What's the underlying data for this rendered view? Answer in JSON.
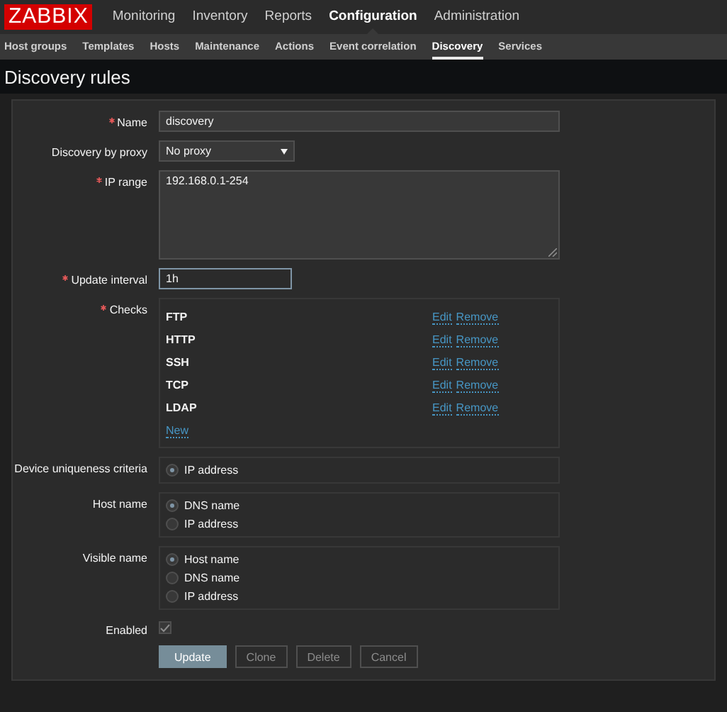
{
  "brand": "ZABBIX",
  "main_menu": [
    {
      "label": "Monitoring",
      "selected": false
    },
    {
      "label": "Inventory",
      "selected": false
    },
    {
      "label": "Reports",
      "selected": false
    },
    {
      "label": "Configuration",
      "selected": true
    },
    {
      "label": "Administration",
      "selected": false
    }
  ],
  "sub_menu": [
    {
      "label": "Host groups",
      "selected": false
    },
    {
      "label": "Templates",
      "selected": false
    },
    {
      "label": "Hosts",
      "selected": false
    },
    {
      "label": "Maintenance",
      "selected": false
    },
    {
      "label": "Actions",
      "selected": false
    },
    {
      "label": "Event correlation",
      "selected": false
    },
    {
      "label": "Discovery",
      "selected": true
    },
    {
      "label": "Services",
      "selected": false
    }
  ],
  "page_title": "Discovery rules",
  "fields": [
    {
      "kind": "text",
      "label": "Name",
      "required": true,
      "value": "discovery",
      "focused": false
    },
    {
      "kind": "select",
      "label": "Discovery by proxy",
      "required": false,
      "value": "No proxy"
    },
    {
      "kind": "textarea",
      "label": "IP range",
      "required": true,
      "value": "192.168.0.1-254"
    },
    {
      "kind": "short",
      "label": "Update interval",
      "required": true,
      "value": "1h",
      "focused": true
    },
    {
      "kind": "checks",
      "label": "Checks",
      "required": true,
      "new_link": "New",
      "items": [
        {
          "name": "FTP",
          "edit": "Edit",
          "remove": "Remove"
        },
        {
          "name": "HTTP",
          "edit": "Edit",
          "remove": "Remove"
        },
        {
          "name": "SSH",
          "edit": "Edit",
          "remove": "Remove"
        },
        {
          "name": "TCP",
          "edit": "Edit",
          "remove": "Remove"
        },
        {
          "name": "LDAP",
          "edit": "Edit",
          "remove": "Remove"
        }
      ]
    },
    {
      "kind": "radio",
      "label": "Device uniqueness criteria",
      "required": false,
      "options": [
        {
          "label": "IP address",
          "selected": true
        }
      ]
    },
    {
      "kind": "radio",
      "label": "Host name",
      "required": false,
      "options": [
        {
          "label": "DNS name",
          "selected": true
        },
        {
          "label": "IP address",
          "selected": false
        }
      ]
    },
    {
      "kind": "radio",
      "label": "Visible name",
      "required": false,
      "options": [
        {
          "label": "Host name",
          "selected": true
        },
        {
          "label": "DNS name",
          "selected": false
        },
        {
          "label": "IP address",
          "selected": false
        }
      ]
    },
    {
      "kind": "checkbox",
      "label": "Enabled",
      "required": false,
      "checked": true
    }
  ],
  "buttons": [
    {
      "label": "Update",
      "primary": true
    },
    {
      "label": "Clone",
      "primary": false
    },
    {
      "label": "Delete",
      "primary": false
    },
    {
      "label": "Cancel",
      "primary": false
    }
  ]
}
